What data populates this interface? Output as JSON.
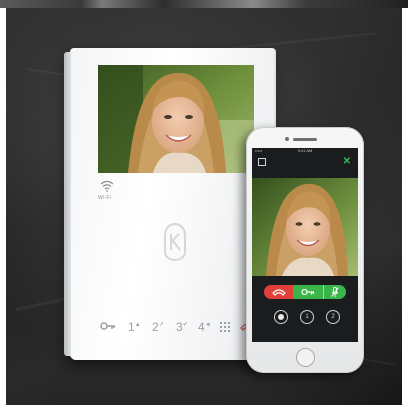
{
  "monitor": {
    "wifi_label": "Wi-Fi",
    "keys": [
      {
        "num": "1",
        "mark": "▲"
      },
      {
        "num": "2",
        "mark": "↗"
      },
      {
        "num": "3",
        "mark": "✔"
      },
      {
        "num": "4",
        "mark": "◄"
      }
    ]
  },
  "phone": {
    "status_time": "9:41 AM",
    "status_left": "•••••",
    "app_left": "☐",
    "app_close": "✕",
    "buttons": [
      {
        "name": "hangup"
      },
      {
        "name": "door-key"
      },
      {
        "name": "mic-mute"
      }
    ],
    "circle_buttons": [
      {
        "label": ""
      },
      {
        "label": "1"
      },
      {
        "label": "2"
      }
    ]
  },
  "colors": {
    "background": "#1f1f1f",
    "hangup_red": "#e0403a",
    "action_green": "#39b54a",
    "device_white": "#f4f5f6"
  }
}
